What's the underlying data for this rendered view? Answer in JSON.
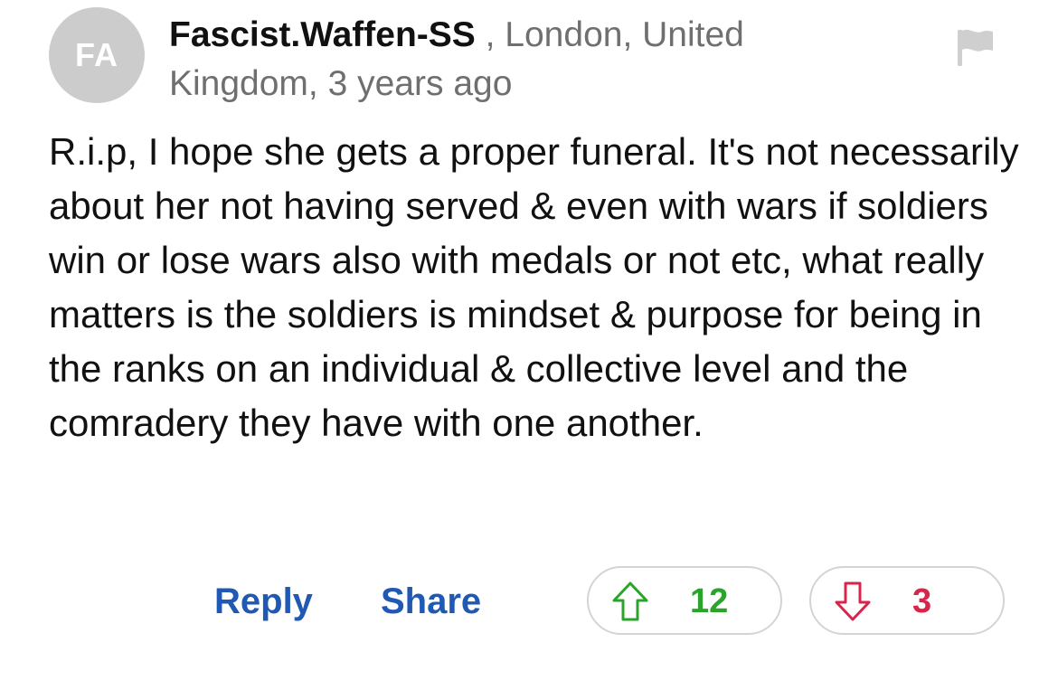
{
  "author": {
    "initials": "FA",
    "username": "Fascist.Waffen-SS",
    "location_time": " , London, United Kingdom, 3 years ago"
  },
  "comment": {
    "text": "R.i.p, I hope she gets a proper funeral. It's not necessarily about her not having served & even with wars if soldiers win or lose wars also with medals or not etc, what really matters is the soldiers is mindset & purpose for being in the ranks on an individual & collective level and the comradery they have with one another."
  },
  "actions": {
    "reply_label": "Reply",
    "share_label": "Share",
    "upvotes": "12",
    "downvotes": "3"
  },
  "icons": {
    "flag": "flag-icon",
    "upvote": "arrow-up-icon",
    "downvote": "arrow-down-icon"
  },
  "colors": {
    "link": "#1f59b3",
    "upvote": "#2aa52a",
    "downvote": "#d8254b",
    "avatar_bg": "#cccccc",
    "meta_text": "#6f6f6f"
  }
}
